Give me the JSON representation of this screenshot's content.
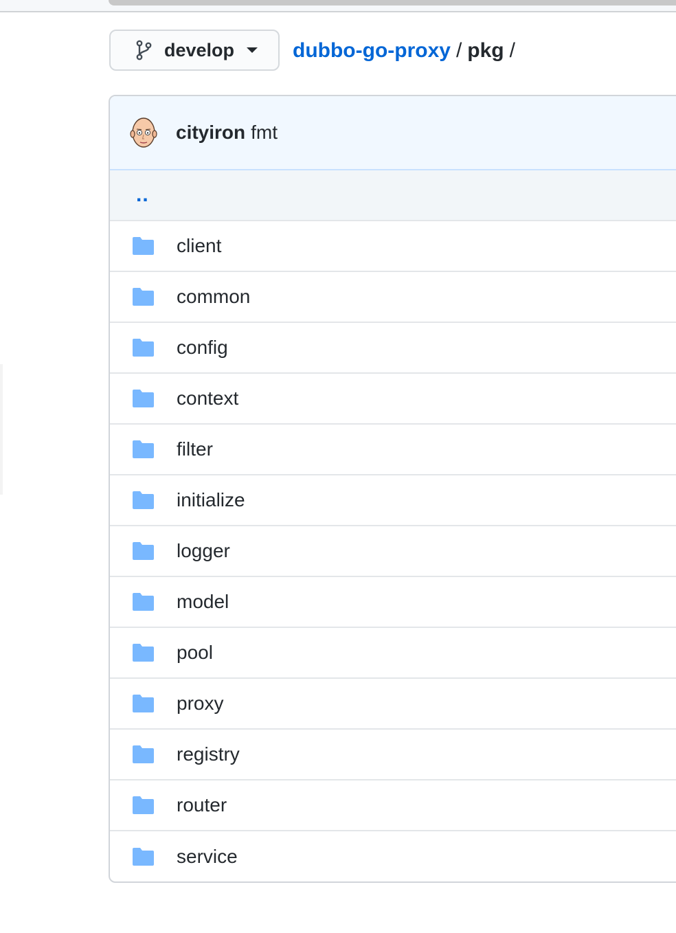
{
  "branch": {
    "label": "develop",
    "icon": "git-branch-icon"
  },
  "breadcrumb": {
    "repo": "dubbo-go-proxy",
    "separator": "/",
    "current": "pkg",
    "trailing": "/"
  },
  "commit": {
    "author": "cityiron",
    "message": "fmt",
    "avatar": "avatar-icon"
  },
  "parent_link": "..",
  "folders": [
    {
      "name": "client"
    },
    {
      "name": "common"
    },
    {
      "name": "config"
    },
    {
      "name": "context"
    },
    {
      "name": "filter"
    },
    {
      "name": "initialize"
    },
    {
      "name": "logger"
    },
    {
      "name": "model"
    },
    {
      "name": "pool"
    },
    {
      "name": "proxy"
    },
    {
      "name": "registry"
    },
    {
      "name": "router"
    },
    {
      "name": "service"
    }
  ],
  "colors": {
    "link": "#0366d6",
    "folder": "#79b8ff",
    "header_bg": "#f1f8ff"
  }
}
